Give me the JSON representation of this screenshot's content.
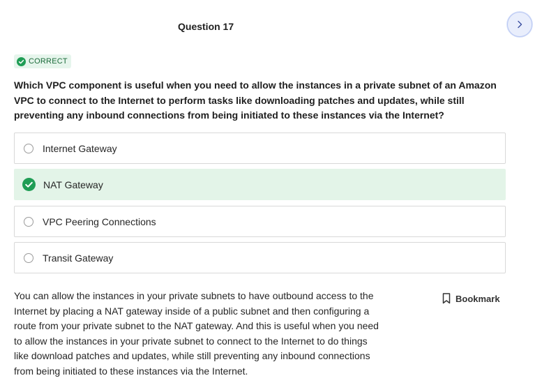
{
  "header": {
    "question_title": "Question 17",
    "next_icon": "chevron-right-icon"
  },
  "status": {
    "label": "CORRECT",
    "icon": "check-circle-icon",
    "color": "#1f9d55"
  },
  "question": {
    "text": "Which VPC component is useful when you need to allow the instances in a private subnet of an Amazon VPC to connect to the Internet to perform tasks like downloading patches and updates, while still preventing any inbound connections from being initiated to these instances via the Internet?"
  },
  "options": [
    {
      "label": "Internet Gateway",
      "selected": false,
      "correct": false
    },
    {
      "label": "NAT Gateway",
      "selected": true,
      "correct": true
    },
    {
      "label": "VPC Peering Connections",
      "selected": false,
      "correct": false
    },
    {
      "label": "Transit Gateway",
      "selected": false,
      "correct": false
    }
  ],
  "explanation": {
    "text": "You can allow the instances in your private subnets to have outbound access to the Internet by placing a NAT gateway inside of a public subnet and then configuring a route from your private subnet to the NAT gateway. And this is useful when you need to allow the instances in your private subnet to connect to the Internet to do things like download patches and updates, while still preventing any inbound connections from being initiated to these instances via the Internet."
  },
  "bookmark": {
    "label": "Bookmark",
    "icon": "bookmark-icon"
  },
  "colors": {
    "correct_bg": "#e3f4e8",
    "accent_green": "#1f9d55",
    "next_button_bg": "#e9eefc"
  }
}
